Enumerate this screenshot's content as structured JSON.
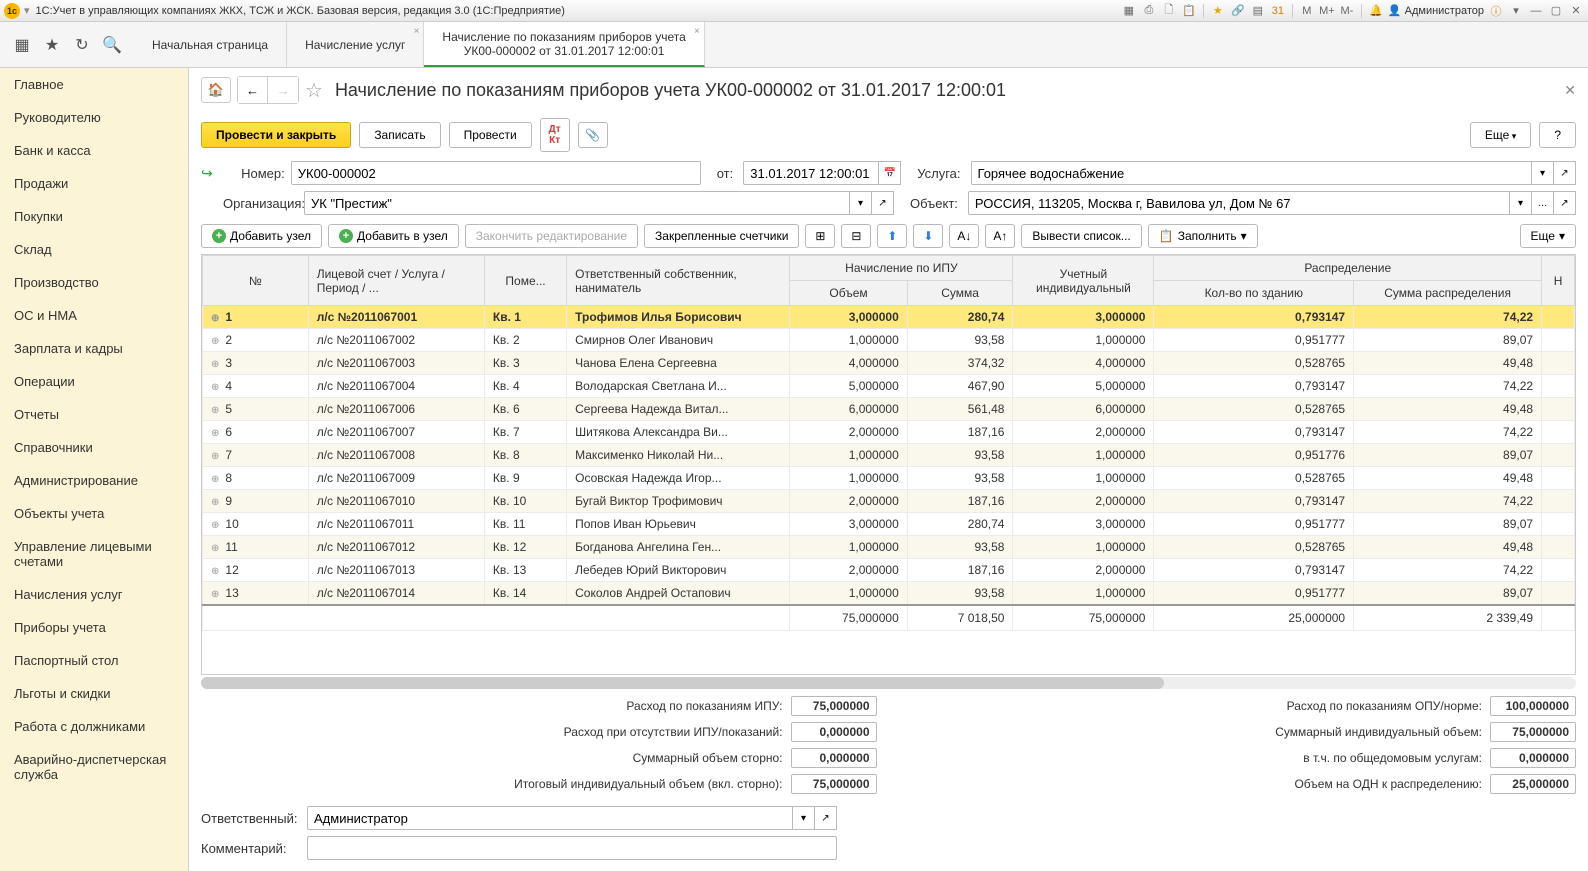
{
  "titlebar": {
    "title": "1С:Учет в управляющих компаниях ЖКХ, ТСЖ и ЖСК. Базовая версия, редакция 3.0  (1С:Предприятие)",
    "user": "Администратор"
  },
  "tabs": [
    {
      "label": "Начальная страница"
    },
    {
      "label": "Начисление услуг"
    },
    {
      "label": "Начисление по показаниям приборов учета",
      "line2": "УК00-000002 от 31.01.2017 12:00:01",
      "active": true
    }
  ],
  "sidebar": {
    "items": [
      "Главное",
      "Руководителю",
      "Банк и касса",
      "Продажи",
      "Покупки",
      "Склад",
      "Производство",
      "ОС и НМА",
      "Зарплата и кадры",
      "Операции",
      "Отчеты",
      "Справочники",
      "Администрирование",
      "Объекты учета",
      "Управление лицевыми счетами",
      "Начисления услуг",
      "Приборы учета",
      "Паспортный стол",
      "Льготы и скидки",
      "Работа с должниками",
      "Аварийно-диспетчерская служба"
    ]
  },
  "page": {
    "title": "Начисление по показаниям приборов учета УК00-000002 от 31.01.2017 12:00:01",
    "actions": {
      "post_close": "Провести и закрыть",
      "write": "Записать",
      "post": "Провести",
      "more": "Еще",
      "help": "?"
    }
  },
  "form": {
    "number_label": "Номер:",
    "number": "УК00-000002",
    "from_label": "от:",
    "date": "31.01.2017 12:00:01",
    "service_label": "Услуга:",
    "service": "Горячее водоснабжение",
    "org_label": "Организация:",
    "org": "УК \"Престиж\"",
    "object_label": "Объект:",
    "object": "РОССИЯ, 113205, Москва г, Вавилова ул, Дом № 67"
  },
  "toolbar2": {
    "add_node": "Добавить узел",
    "add_into": "Добавить в узел",
    "end_edit": "Закончить редактирование",
    "pinned": "Закрепленные счетчики",
    "output_list": "Вывести список...",
    "fill": "Заполнить",
    "more": "Еще"
  },
  "grid": {
    "headers": {
      "no": "№",
      "account": "Лицевой счет / Услуга / Период / ...",
      "room": "Поме...",
      "owner": "Ответственный собственник, наниматель",
      "ipu": "Начисление по ИПУ",
      "ipu_vol": "Объем",
      "ipu_sum": "Сумма",
      "indiv": "Учетный индивидуальный",
      "dist": "Распределение",
      "dist_qty": "Кол-во по зданию",
      "dist_sum": "Сумма распределения",
      "h": "Н"
    },
    "rows": [
      {
        "n": "1",
        "acc": "л/с №2011067001",
        "room": "Кв. 1",
        "own": "Трофимов Илья Борисович",
        "vol": "3,000000",
        "sum": "280,74",
        "ind": "3,000000",
        "dq": "0,793147",
        "ds": "74,22",
        "sel": true
      },
      {
        "n": "2",
        "acc": "л/с №2011067002",
        "room": "Кв. 2",
        "own": "Смирнов Олег Иванович",
        "vol": "1,000000",
        "sum": "93,58",
        "ind": "1,000000",
        "dq": "0,951777",
        "ds": "89,07"
      },
      {
        "n": "3",
        "acc": "л/с №2011067003",
        "room": "Кв. 3",
        "own": "Чанова Елена Сергеевна",
        "vol": "4,000000",
        "sum": "374,32",
        "ind": "4,000000",
        "dq": "0,528765",
        "ds": "49,48"
      },
      {
        "n": "4",
        "acc": "л/с №2011067004",
        "room": "Кв. 4",
        "own": "Володарская Светлана И...",
        "vol": "5,000000",
        "sum": "467,90",
        "ind": "5,000000",
        "dq": "0,793147",
        "ds": "74,22"
      },
      {
        "n": "5",
        "acc": "л/с №2011067006",
        "room": "Кв. 6",
        "own": "Сергеева Надежда Витал...",
        "vol": "6,000000",
        "sum": "561,48",
        "ind": "6,000000",
        "dq": "0,528765",
        "ds": "49,48"
      },
      {
        "n": "6",
        "acc": "л/с №2011067007",
        "room": "Кв. 7",
        "own": "Шитякова Александра Ви...",
        "vol": "2,000000",
        "sum": "187,16",
        "ind": "2,000000",
        "dq": "0,793147",
        "ds": "74,22"
      },
      {
        "n": "7",
        "acc": "л/с №2011067008",
        "room": "Кв. 8",
        "own": "Максименко Николай Ни...",
        "vol": "1,000000",
        "sum": "93,58",
        "ind": "1,000000",
        "dq": "0,951776",
        "ds": "89,07"
      },
      {
        "n": "8",
        "acc": "л/с №2011067009",
        "room": "Кв. 9",
        "own": "Осовская Надежда Игор...",
        "vol": "1,000000",
        "sum": "93,58",
        "ind": "1,000000",
        "dq": "0,528765",
        "ds": "49,48"
      },
      {
        "n": "9",
        "acc": "л/с №2011067010",
        "room": "Кв. 10",
        "own": "Бугай Виктор Трофимович",
        "vol": "2,000000",
        "sum": "187,16",
        "ind": "2,000000",
        "dq": "0,793147",
        "ds": "74,22"
      },
      {
        "n": "10",
        "acc": "л/с №2011067011",
        "room": "Кв. 11",
        "own": "Попов Иван Юрьевич",
        "vol": "3,000000",
        "sum": "280,74",
        "ind": "3,000000",
        "dq": "0,951777",
        "ds": "89,07"
      },
      {
        "n": "11",
        "acc": "л/с №2011067012",
        "room": "Кв. 12",
        "own": "Богданова Ангелина Ген...",
        "vol": "1,000000",
        "sum": "93,58",
        "ind": "1,000000",
        "dq": "0,528765",
        "ds": "49,48"
      },
      {
        "n": "12",
        "acc": "л/с №2011067013",
        "room": "Кв. 13",
        "own": "Лебедев Юрий Викторович",
        "vol": "2,000000",
        "sum": "187,16",
        "ind": "2,000000",
        "dq": "0,793147",
        "ds": "74,22"
      },
      {
        "n": "13",
        "acc": "л/с №2011067014",
        "room": "Кв. 14",
        "own": "Соколов Андрей Остапович",
        "vol": "1,000000",
        "sum": "93,58",
        "ind": "1,000000",
        "dq": "0,951777",
        "ds": "89,07"
      }
    ],
    "totals": {
      "vol": "75,000000",
      "sum": "7 018,50",
      "ind": "75,000000",
      "dq": "25,000000",
      "ds": "2 339,49"
    }
  },
  "summary": {
    "l1": "Расход по показаниям ИПУ:",
    "v1": "75,000000",
    "l2": "Расход при отсутствии ИПУ/показаний:",
    "v2": "0,000000",
    "l3": "Суммарный объем сторно:",
    "v3": "0,000000",
    "l4": "Итоговый индивидуальный объем (вкл. сторно):",
    "v4": "75,000000",
    "r1": "Расход по показаниям ОПУ/норме:",
    "rv1": "100,000000",
    "r2": "Суммарный индивидуальный объем:",
    "rv2": "75,000000",
    "r3": "в т.ч. по общедомовым услугам:",
    "rv3": "0,000000",
    "r4": "Объем на ОДН к распределению:",
    "rv4": "25,000000"
  },
  "bottom": {
    "resp_label": "Ответственный:",
    "resp": "Администратор",
    "comment_label": "Комментарий:",
    "comment": ""
  }
}
